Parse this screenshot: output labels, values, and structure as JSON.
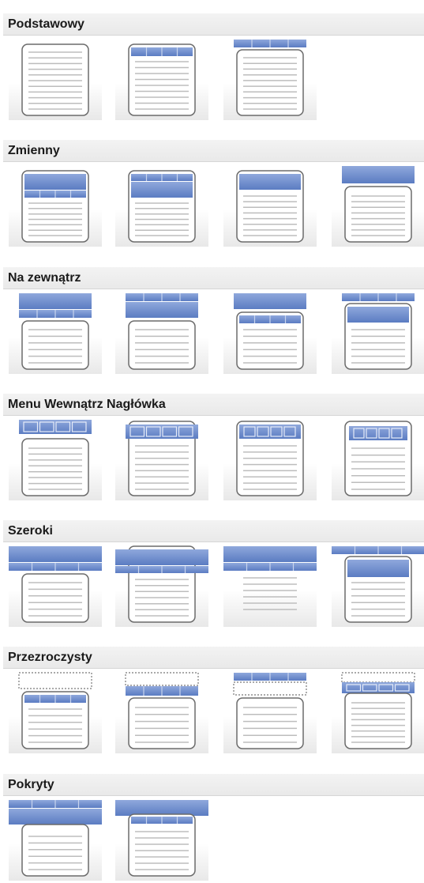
{
  "sections": [
    {
      "title": "Podstawowy",
      "layouts": [
        "plain",
        "header-bar-inside",
        "bar-above"
      ]
    },
    {
      "title": "Zmienny",
      "layouts": [
        "banner-bar",
        "bar-banner",
        "banner-only",
        "banner-above-body"
      ]
    },
    {
      "title": "Na zewnątrz",
      "layouts": [
        "out-banner-bar",
        "out-bar-banner",
        "out-banner-frame-bar",
        "out-bar-frame-banner"
      ]
    },
    {
      "title": "Menu Wewnątrz Nagłówka",
      "layouts": [
        "menu-header-out",
        "menu-header-mid",
        "menu-header-in",
        "menu-header-in-frame"
      ]
    },
    {
      "title": "Szeroki",
      "layouts": [
        "wide-banner-bar",
        "wide-frame-banner",
        "wide-flat",
        "wide-bar-banner"
      ]
    },
    {
      "title": "Przezroczysty",
      "layouts": [
        "trans-top",
        "trans-top-bar",
        "trans-bar-top",
        "trans-top-iconbar"
      ]
    },
    {
      "title": "Pokryty",
      "layouts": [
        "covered-bar-banner",
        "covered-banner-bar"
      ]
    }
  ],
  "colors": {
    "accent": "#5b7cc2",
    "accent_light": "#8fa8dc",
    "border": "#6b6b6b",
    "line": "#bdbdbd"
  }
}
